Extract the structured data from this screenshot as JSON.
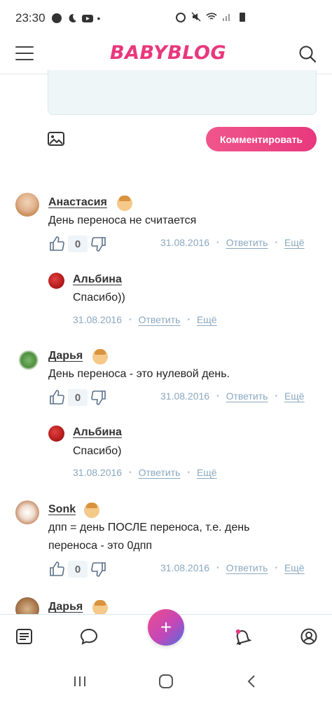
{
  "status_bar": {
    "time": "23:30"
  },
  "header": {
    "logo": "BABYBLOG"
  },
  "composer": {
    "submit_label": "Комментировать"
  },
  "comments": [
    {
      "author": "Анастасия",
      "text": "День переноса не считается",
      "likes": "0",
      "date": "31.08.2016",
      "reply": "Ответить",
      "more": "Ещё"
    },
    {
      "author": "Альбина",
      "text": "Спасибо))",
      "date": "31.08.2016",
      "reply": "Ответить",
      "more": "Ещё"
    },
    {
      "author": "Дарья",
      "text": "День переноса - это нулевой день.",
      "likes": "0",
      "date": "31.08.2016",
      "reply": "Ответить",
      "more": "Ещё"
    },
    {
      "author": "Альбина",
      "text": "Спасибо)",
      "date": "31.08.2016",
      "reply": "Ответить",
      "more": "Ещё"
    },
    {
      "author": "Sonk",
      "text_line1": "дпп = день ПОСЛЕ переноса, т.е. день",
      "text_line2": "переноса - это 0дпп",
      "likes": "0",
      "date": "31.08.2016",
      "reply": "Ответить",
      "more": "Ещё"
    },
    {
      "author": "Дарья"
    }
  ],
  "bottom_nav": {
    "fab": "+"
  },
  "colors": {
    "brand": "#e8387d",
    "link": "#8aa8c0",
    "box": "#eef6f8"
  }
}
